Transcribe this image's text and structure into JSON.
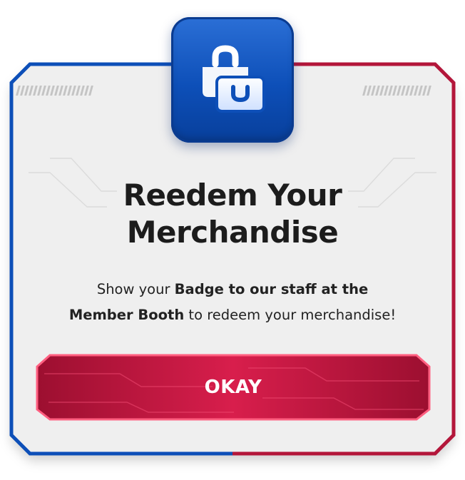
{
  "dialog": {
    "title_line1": "Reedem Your",
    "title_line2": "Merchandise",
    "message": {
      "part1": "Show your ",
      "bold1": "Badge to our staff at the",
      "bold2": "Member Booth",
      "part2": " to redeem your merchandise!"
    },
    "icon": "shopping-bag-icon",
    "okay_label": "OKAY"
  },
  "colors": {
    "blue_accent": "#0d4fb8",
    "red_accent": "#b3163a",
    "button_red": "#c91a45",
    "button_border": "#ff5a7a",
    "panel_bg": "#efefef"
  }
}
